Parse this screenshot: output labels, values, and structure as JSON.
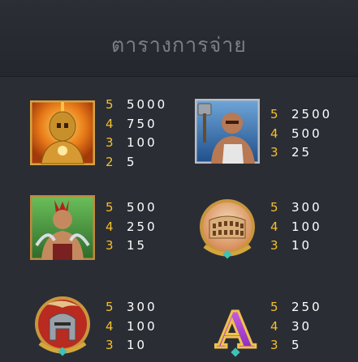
{
  "header": {
    "title": "ตารางการจ่าย"
  },
  "symbols": [
    {
      "icon": "golden-warrior-icon",
      "pays": [
        {
          "count": "5",
          "value": "5000"
        },
        {
          "count": "4",
          "value": "750"
        },
        {
          "count": "3",
          "value": "100"
        },
        {
          "count": "2",
          "value": "5"
        }
      ]
    },
    {
      "icon": "hammer-gladiator-icon",
      "pays": [
        {
          "count": "5",
          "value": "2500"
        },
        {
          "count": "4",
          "value": "500"
        },
        {
          "count": "3",
          "value": "25"
        }
      ]
    },
    {
      "icon": "mohawk-gladiator-icon",
      "pays": [
        {
          "count": "5",
          "value": "500"
        },
        {
          "count": "4",
          "value": "250"
        },
        {
          "count": "3",
          "value": "15"
        }
      ]
    },
    {
      "icon": "colosseum-icon",
      "pays": [
        {
          "count": "5",
          "value": "300"
        },
        {
          "count": "4",
          "value": "100"
        },
        {
          "count": "3",
          "value": "10"
        }
      ]
    },
    {
      "icon": "helmet-icon",
      "pays": [
        {
          "count": "5",
          "value": "300"
        },
        {
          "count": "4",
          "value": "100"
        },
        {
          "count": "3",
          "value": "10"
        }
      ]
    },
    {
      "icon": "letter-a-icon",
      "letter": "A",
      "pays": [
        {
          "count": "5",
          "value": "250"
        },
        {
          "count": "4",
          "value": "30"
        },
        {
          "count": "3",
          "value": "5"
        }
      ]
    }
  ],
  "colors": {
    "background": "#2b2d35",
    "count": "#f5c028",
    "value": "#ffffff",
    "title": "#7c7e86"
  }
}
